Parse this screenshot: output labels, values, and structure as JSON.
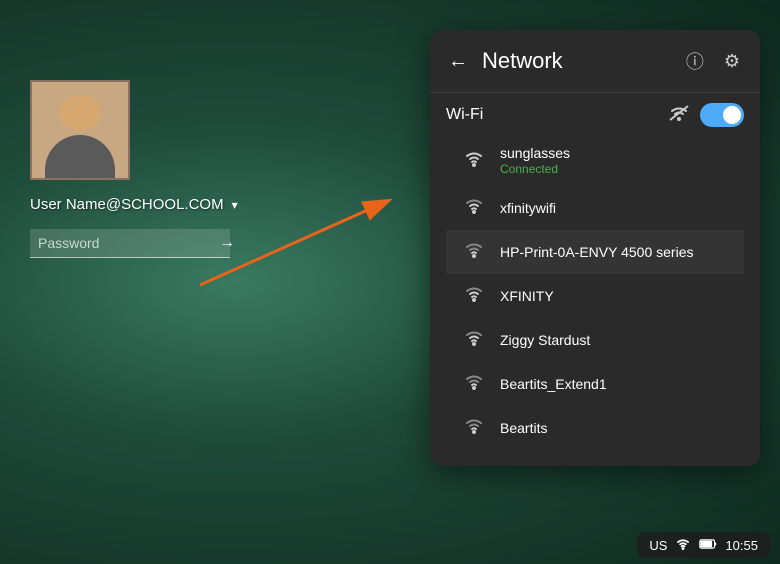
{
  "background": {
    "color_start": "#3a7a60",
    "color_end": "#0f2a20"
  },
  "login": {
    "username": "User Name@SCHOOL.COM",
    "password_placeholder": "Password",
    "dropdown_label": "▾",
    "arrow_label": "→"
  },
  "network_panel": {
    "title": "Network",
    "back_icon": "←",
    "info_icon": "ⓘ",
    "settings_icon": "⚙",
    "wifi_section_label": "Wi-Fi",
    "wifi_enabled": true,
    "networks": [
      {
        "name": "sunglasses",
        "status": "Connected",
        "signal": 4,
        "connected": true
      },
      {
        "name": "xfinitywifi",
        "status": "",
        "signal": 3,
        "connected": false
      },
      {
        "name": "HP-Print-0A-ENVY 4500 series",
        "status": "",
        "signal": 2,
        "connected": false
      },
      {
        "name": "XFINITY",
        "status": "",
        "signal": 3,
        "connected": false
      },
      {
        "name": "Ziggy Stardust",
        "status": "",
        "signal": 3,
        "connected": false
      },
      {
        "name": "Beartits_Extend1",
        "status": "",
        "signal": 2,
        "connected": false
      },
      {
        "name": "Beartits",
        "status": "",
        "signal": 2,
        "connected": false
      }
    ]
  },
  "taskbar": {
    "locale": "US",
    "time": "10:55"
  }
}
